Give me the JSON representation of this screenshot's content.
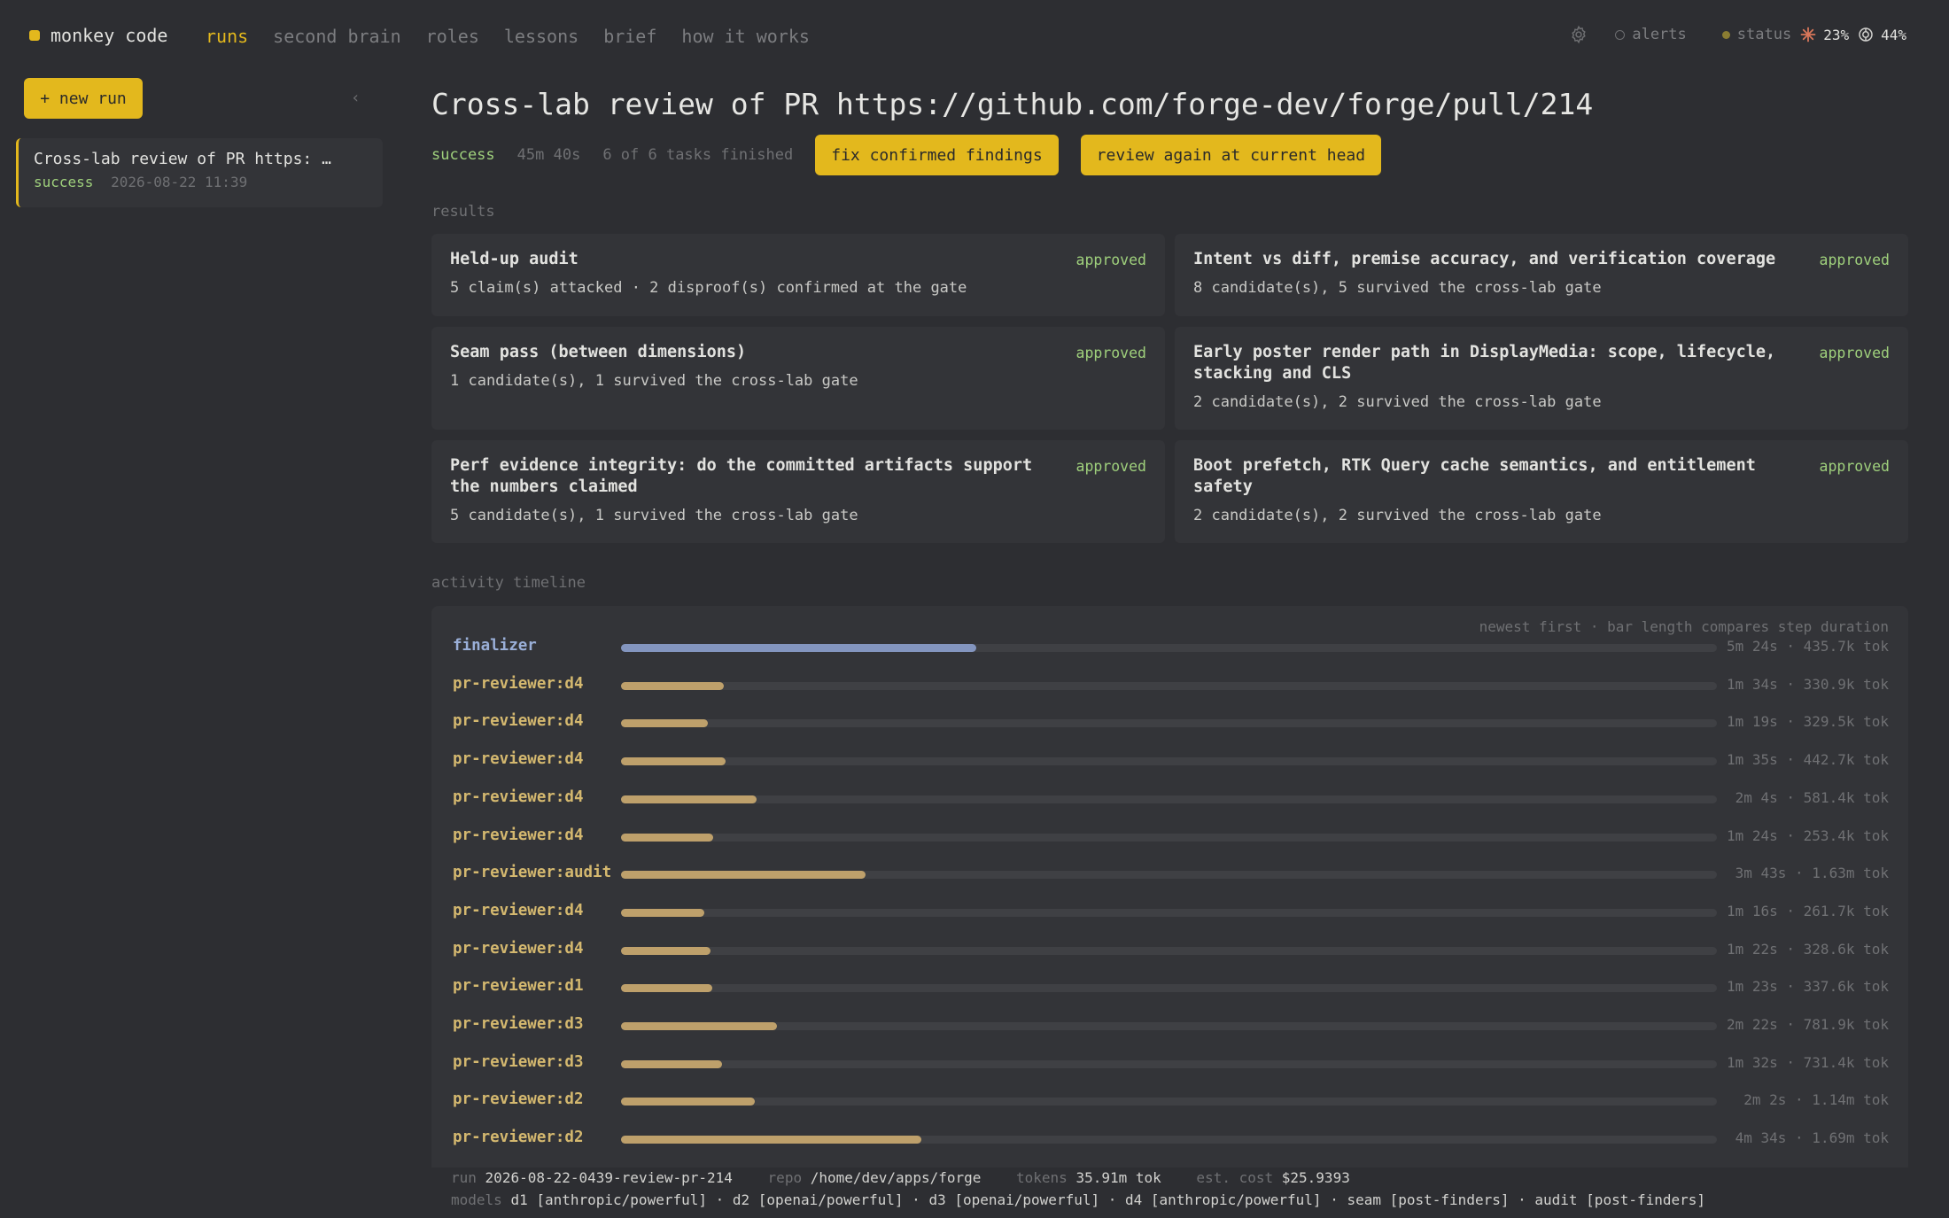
{
  "brand": {
    "name": "monkey code"
  },
  "nav": [
    "runs",
    "second brain",
    "roles",
    "lessons",
    "brief",
    "how it works"
  ],
  "topbar": {
    "alerts": "alerts",
    "status": "status",
    "metric1": "23%",
    "metric2": "44%"
  },
  "sidebar": {
    "new_run": "+ new run",
    "collapse": "‹",
    "run": {
      "title": "Cross-lab review of PR https: …",
      "status": "success",
      "time": "2026-08-22 11:39"
    }
  },
  "run": {
    "title": "Cross-lab review of PR https://github.com/forge-dev/forge/pull/214",
    "status": "success",
    "duration": "45m 40s",
    "tasks": "6 of 6 tasks finished",
    "action1": "fix confirmed findings",
    "action2": "review again at current head"
  },
  "sections": {
    "results": "results",
    "timeline": "activity timeline"
  },
  "results": [
    {
      "title": "Held-up audit",
      "status": "approved",
      "sub": "5 claim(s) attacked · 2 disproof(s) confirmed at the gate"
    },
    {
      "title": "Intent vs diff, premise accuracy, and verification coverage",
      "status": "approved",
      "sub": "8 candidate(s), 5 survived the cross-lab gate"
    },
    {
      "title": "Seam pass (between dimensions)",
      "status": "approved",
      "sub": "1 candidate(s), 1 survived the cross-lab gate"
    },
    {
      "title": "Early poster render path in DisplayMedia: scope, lifecycle, stacking and CLS",
      "status": "approved",
      "sub": "2 candidate(s), 2 survived the cross-lab gate"
    },
    {
      "title": "Perf evidence integrity: do the committed artifacts support the numbers claimed",
      "status": "approved",
      "sub": "5 candidate(s), 1 survived the cross-lab gate"
    },
    {
      "title": "Boot prefetch, RTK Query cache semantics, and entitlement safety",
      "status": "approved",
      "sub": "2 candidate(s), 2 survived the cross-lab gate"
    }
  ],
  "timeline": {
    "note": "newest first · bar length compares step duration",
    "rows": [
      {
        "name": "finalizer",
        "stat": "5m 24s · 435.7k tok",
        "seconds": 324
      },
      {
        "name": "pr-reviewer:d4",
        "stat": "1m 34s · 330.9k tok",
        "seconds": 94
      },
      {
        "name": "pr-reviewer:d4",
        "stat": "1m 19s · 329.5k tok",
        "seconds": 79
      },
      {
        "name": "pr-reviewer:d4",
        "stat": "1m 35s · 442.7k tok",
        "seconds": 95
      },
      {
        "name": "pr-reviewer:d4",
        "stat": "2m 4s · 581.4k tok",
        "seconds": 124
      },
      {
        "name": "pr-reviewer:d4",
        "stat": "1m 24s · 253.4k tok",
        "seconds": 84
      },
      {
        "name": "pr-reviewer:audit",
        "stat": "3m 43s · 1.63m tok",
        "seconds": 223
      },
      {
        "name": "pr-reviewer:d4",
        "stat": "1m 16s · 261.7k tok",
        "seconds": 76
      },
      {
        "name": "pr-reviewer:d4",
        "stat": "1m 22s · 328.6k tok",
        "seconds": 82
      },
      {
        "name": "pr-reviewer:d1",
        "stat": "1m 23s · 337.6k tok",
        "seconds": 83
      },
      {
        "name": "pr-reviewer:d3",
        "stat": "2m 22s · 781.9k tok",
        "seconds": 142
      },
      {
        "name": "pr-reviewer:d3",
        "stat": "1m 32s · 731.4k tok",
        "seconds": 92
      },
      {
        "name": "pr-reviewer:d2",
        "stat": "2m 2s · 1.14m tok",
        "seconds": 122
      },
      {
        "name": "pr-reviewer:d2",
        "stat": "4m 34s · 1.69m tok",
        "seconds": 274
      }
    ]
  },
  "footer": {
    "run_label": "run",
    "run_value": "2026-08-22-0439-review-pr-214",
    "repo_label": "repo",
    "repo_value": "/home/dev/apps/forge",
    "tokens_label": "tokens",
    "tokens_value": "35.91m tok",
    "cost_label": "est. cost",
    "cost_value": "$25.9393",
    "models_label": "models",
    "models_value": "d1 [anthropic/powerful] · d2 [openai/powerful] · d3 [openai/powerful] · d4 [anthropic/powerful] · seam [post-finders] · audit [post-finders]"
  },
  "colors": {
    "accent": "#e3b81d",
    "success": "#9fd07c",
    "bar": "#bea06b",
    "bar_final": "#8395bf"
  }
}
